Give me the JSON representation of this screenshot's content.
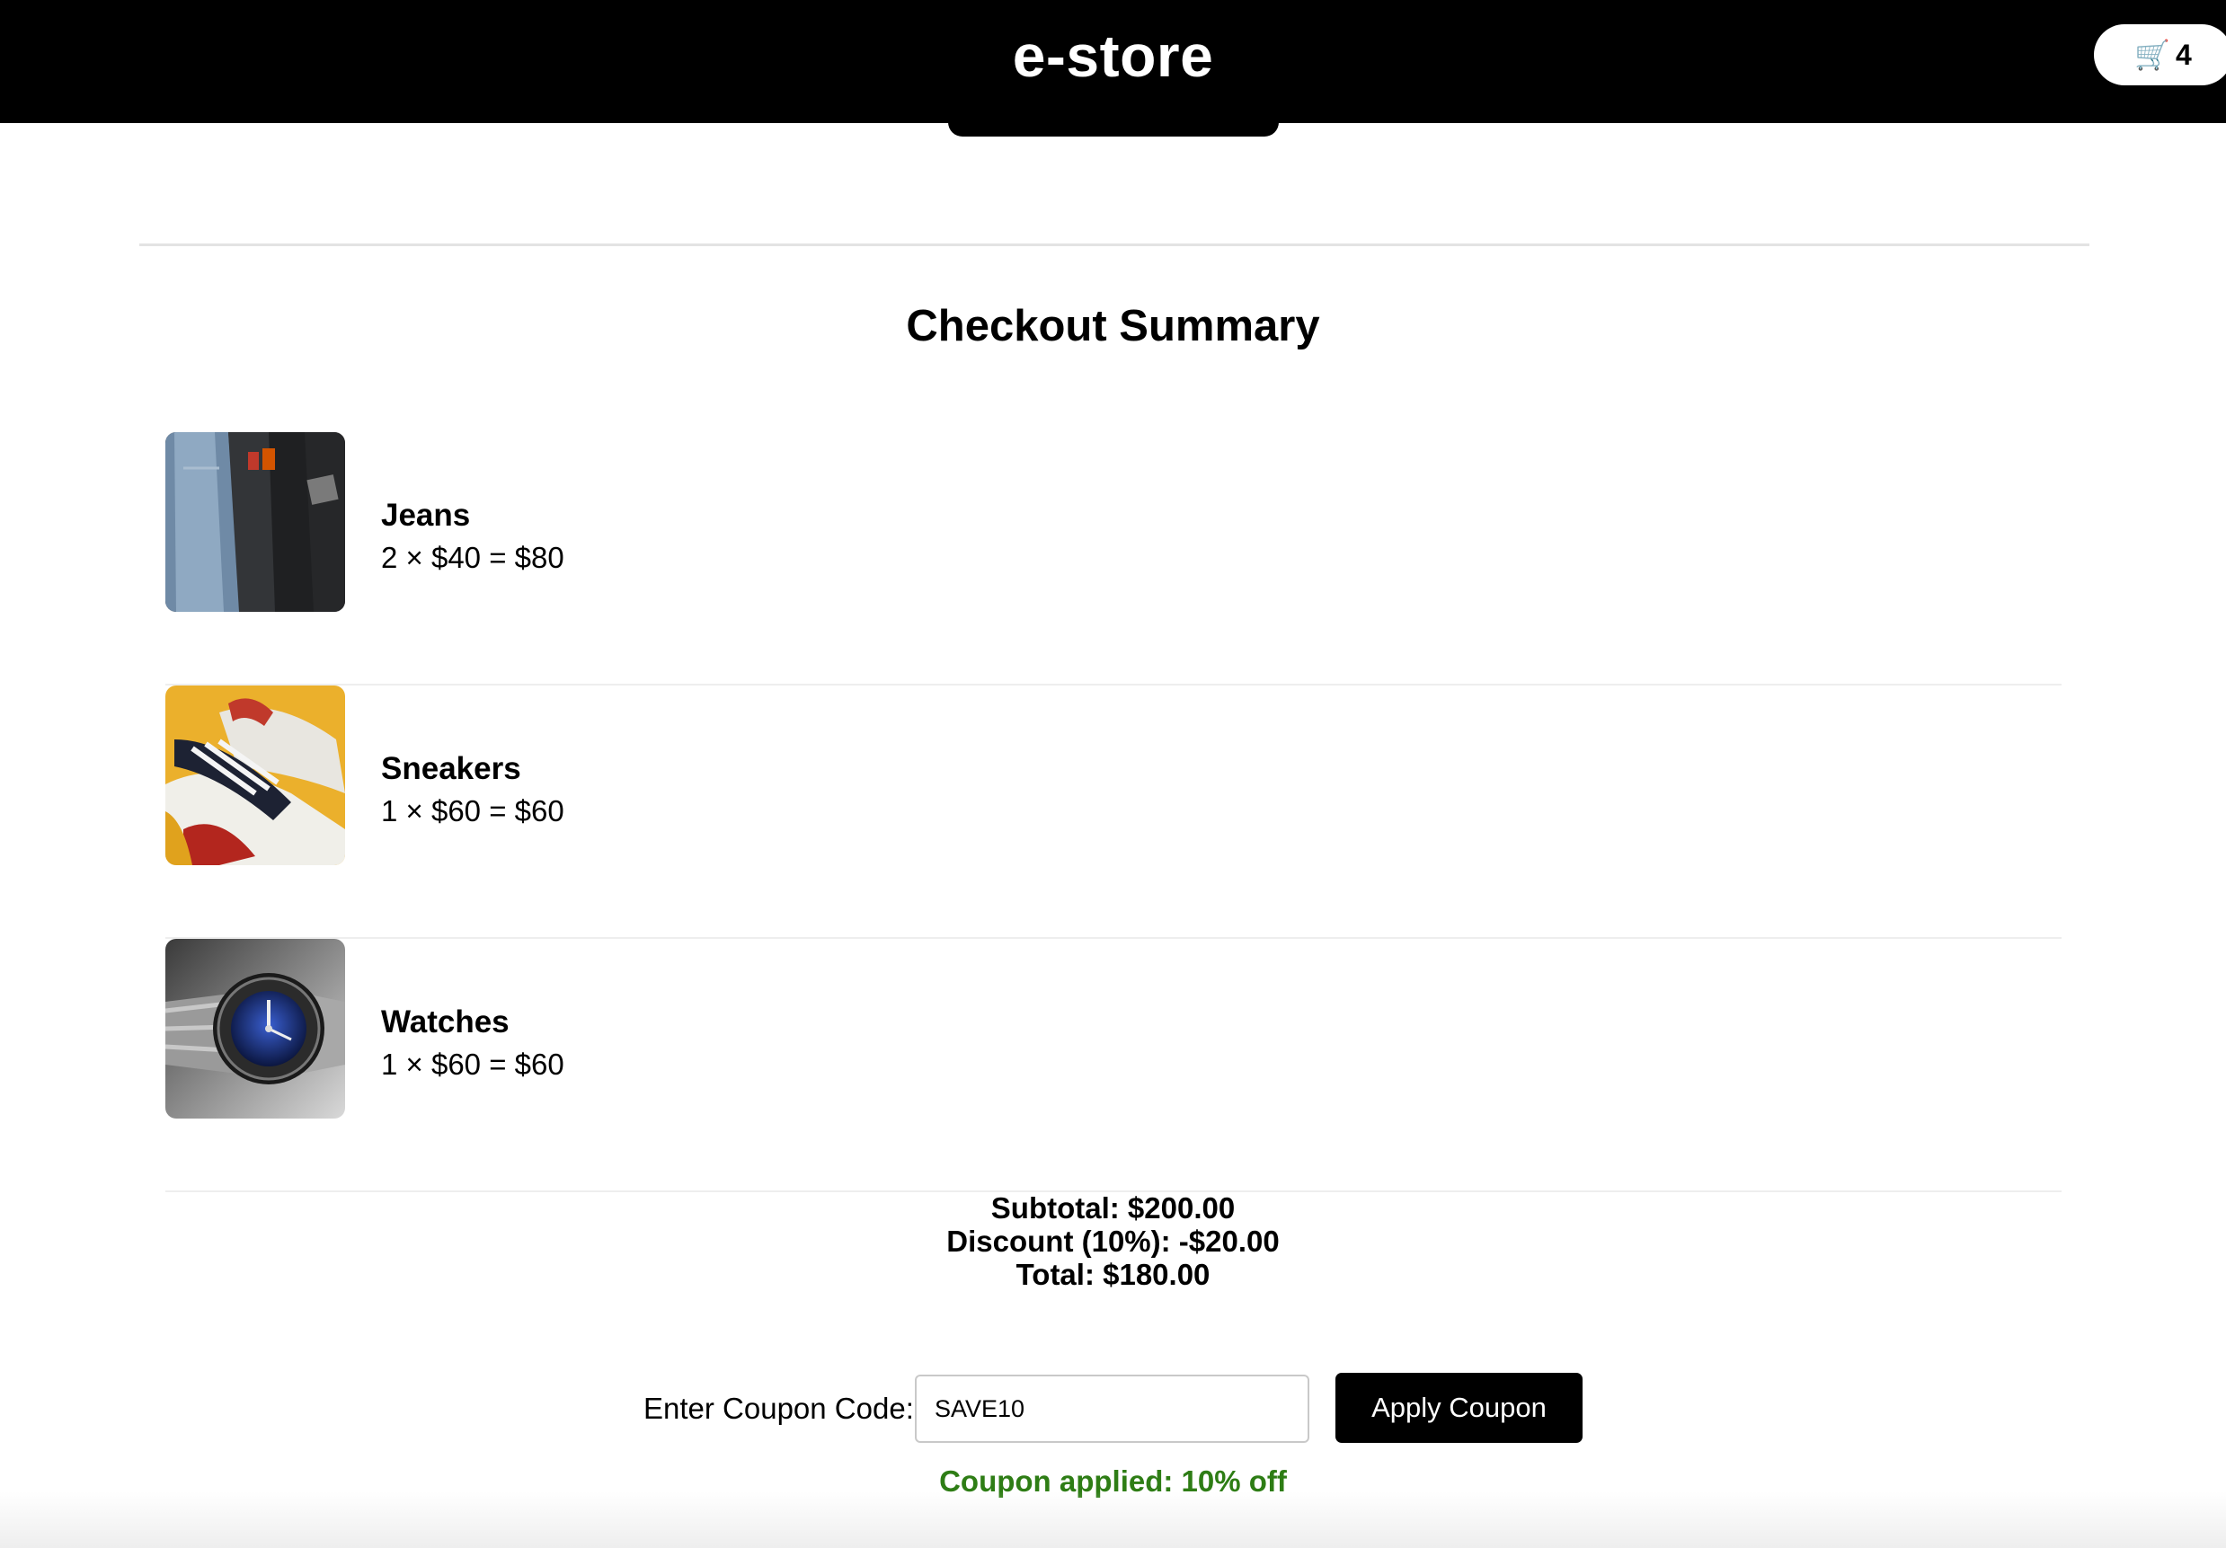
{
  "header": {
    "brand": "e-store",
    "cart_count": "4",
    "cart_icon": "shopping-cart-icon"
  },
  "main": {
    "title": "Checkout Summary",
    "items": [
      {
        "name": "Jeans",
        "line": "2 × $40 = $80",
        "image": "jeans-photo"
      },
      {
        "name": "Sneakers",
        "line": "1 × $60 = $60",
        "image": "sneakers-photo"
      },
      {
        "name": "Watches",
        "line": "1 × $60 = $60",
        "image": "watch-photo"
      }
    ],
    "totals": {
      "subtotal": "Subtotal: $200.00",
      "discount": "Discount (10%): -$20.00",
      "total": "Total: $180.00"
    },
    "coupon": {
      "label": "Enter Coupon Code:",
      "value": "SAVE10",
      "button_label": "Apply Coupon",
      "message": "Coupon applied: 10% off"
    }
  },
  "colors": {
    "header_bg": "#000000",
    "success": "#2e7d15",
    "button_bg": "#000000"
  }
}
